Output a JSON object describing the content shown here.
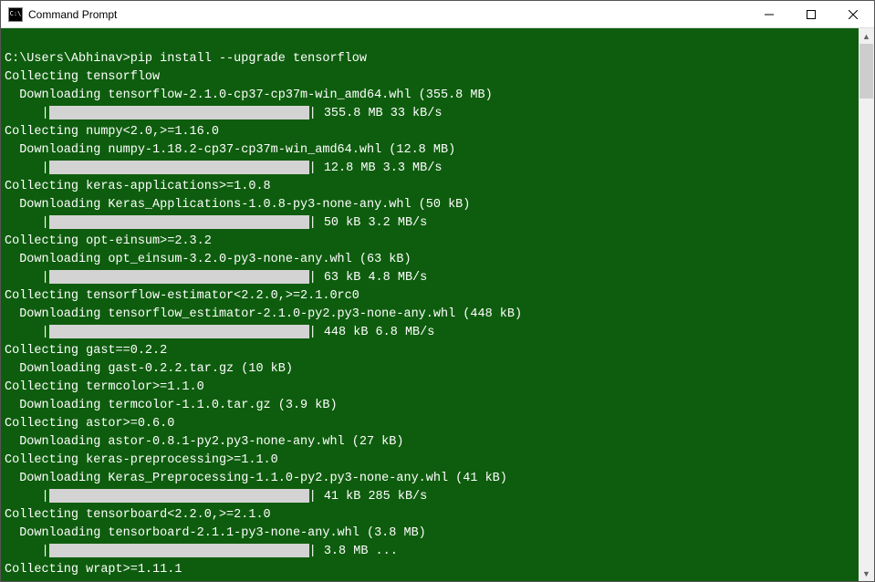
{
  "window": {
    "title": "Command Prompt",
    "icon_text": "C:\\"
  },
  "prompt": {
    "path": "C:\\Users\\Abhinav>",
    "command": "pip install --upgrade tensorflow"
  },
  "lines": [
    {
      "type": "text",
      "text": "Collecting tensorflow"
    },
    {
      "type": "text",
      "text": "  Downloading tensorflow-2.1.0-cp37-cp37m-win_amd64.whl (355.8 MB)"
    },
    {
      "type": "bar",
      "indent": "     ",
      "info": " 355.8 MB 33 kB/s"
    },
    {
      "type": "text",
      "text": "Collecting numpy<2.0,>=1.16.0"
    },
    {
      "type": "text",
      "text": "  Downloading numpy-1.18.2-cp37-cp37m-win_amd64.whl (12.8 MB)"
    },
    {
      "type": "bar",
      "indent": "     ",
      "info": " 12.8 MB 3.3 MB/s"
    },
    {
      "type": "text",
      "text": "Collecting keras-applications>=1.0.8"
    },
    {
      "type": "text",
      "text": "  Downloading Keras_Applications-1.0.8-py3-none-any.whl (50 kB)"
    },
    {
      "type": "bar",
      "indent": "     ",
      "info": " 50 kB 3.2 MB/s"
    },
    {
      "type": "text",
      "text": "Collecting opt-einsum>=2.3.2"
    },
    {
      "type": "text",
      "text": "  Downloading opt_einsum-3.2.0-py3-none-any.whl (63 kB)"
    },
    {
      "type": "bar",
      "indent": "     ",
      "info": " 63 kB 4.8 MB/s"
    },
    {
      "type": "text",
      "text": "Collecting tensorflow-estimator<2.2.0,>=2.1.0rc0"
    },
    {
      "type": "text",
      "text": "  Downloading tensorflow_estimator-2.1.0-py2.py3-none-any.whl (448 kB)"
    },
    {
      "type": "bar",
      "indent": "     ",
      "info": " 448 kB 6.8 MB/s"
    },
    {
      "type": "text",
      "text": "Collecting gast==0.2.2"
    },
    {
      "type": "text",
      "text": "  Downloading gast-0.2.2.tar.gz (10 kB)"
    },
    {
      "type": "text",
      "text": "Collecting termcolor>=1.1.0"
    },
    {
      "type": "text",
      "text": "  Downloading termcolor-1.1.0.tar.gz (3.9 kB)"
    },
    {
      "type": "text",
      "text": "Collecting astor>=0.6.0"
    },
    {
      "type": "text",
      "text": "  Downloading astor-0.8.1-py2.py3-none-any.whl (27 kB)"
    },
    {
      "type": "text",
      "text": "Collecting keras-preprocessing>=1.1.0"
    },
    {
      "type": "text",
      "text": "  Downloading Keras_Preprocessing-1.1.0-py2.py3-none-any.whl (41 kB)"
    },
    {
      "type": "bar",
      "indent": "     ",
      "info": " 41 kB 285 kB/s"
    },
    {
      "type": "text",
      "text": "Collecting tensorboard<2.2.0,>=2.1.0"
    },
    {
      "type": "text",
      "text": "  Downloading tensorboard-2.1.1-py3-none-any.whl (3.8 MB)"
    },
    {
      "type": "bar",
      "indent": "     ",
      "info": " 3.8 MB ..."
    },
    {
      "type": "text",
      "text": "Collecting wrapt>=1.11.1"
    }
  ]
}
